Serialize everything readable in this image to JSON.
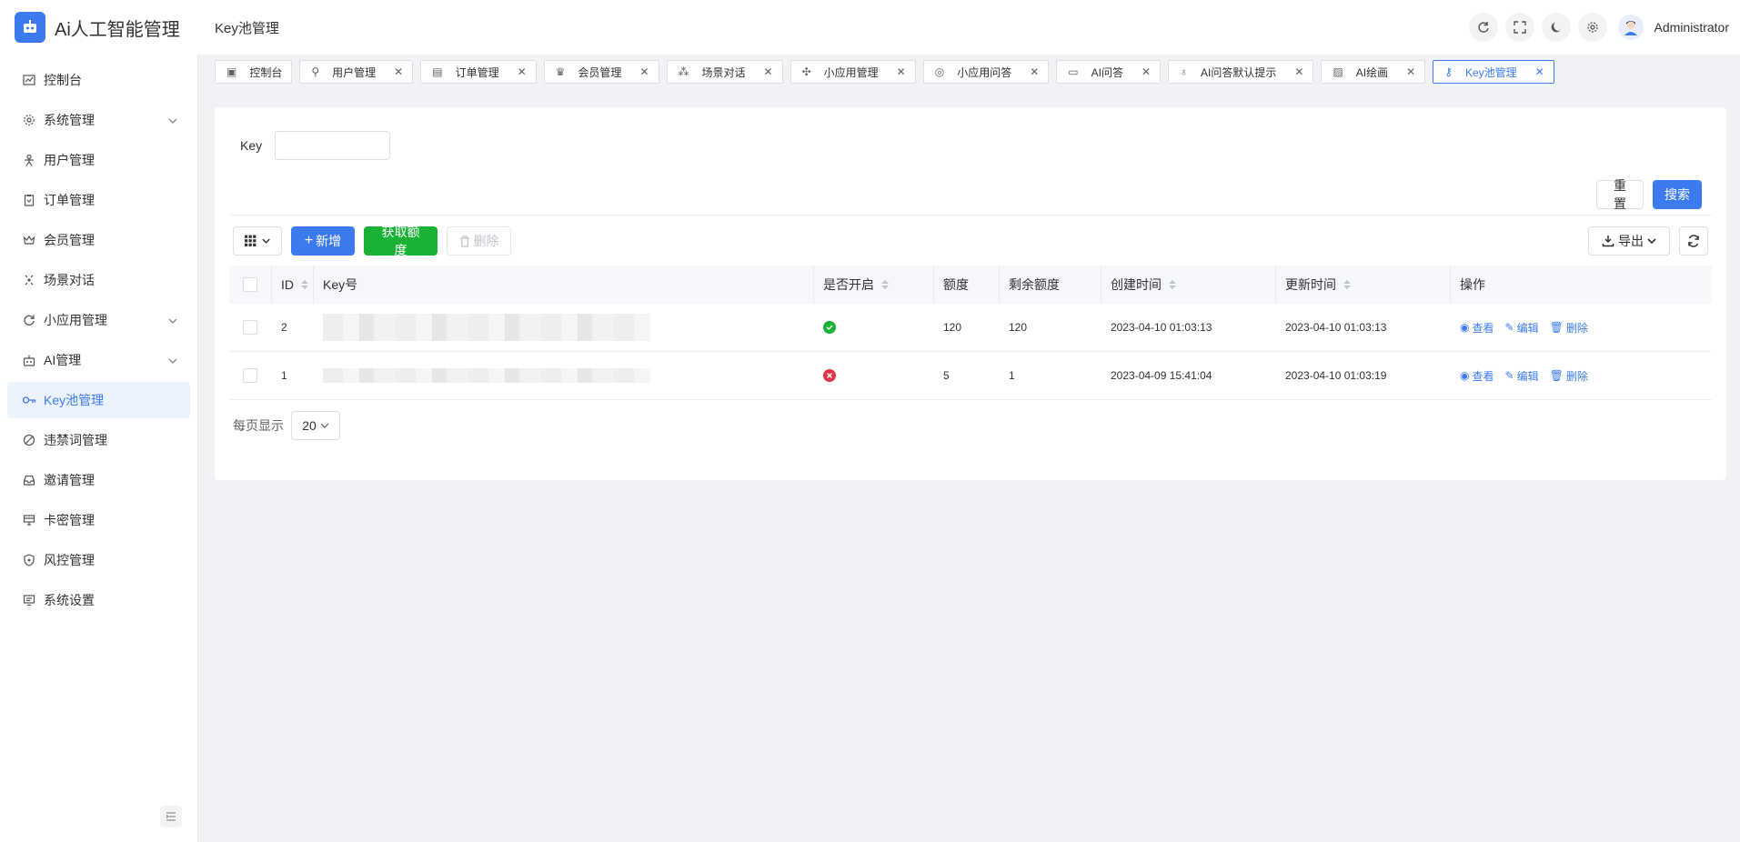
{
  "app": {
    "title": "Ai人工智能管理",
    "page_title": "Key池管理",
    "username": "Administrator"
  },
  "sidebar": {
    "items": [
      {
        "label": "控制台",
        "icon": "dashboard-icon"
      },
      {
        "label": "系统管理",
        "icon": "gear-icon",
        "expandable": true
      },
      {
        "label": "用户管理",
        "icon": "user-icon"
      },
      {
        "label": "订单管理",
        "icon": "clipboard-icon"
      },
      {
        "label": "会员管理",
        "icon": "crown-icon"
      },
      {
        "label": "场景对话",
        "icon": "scene-icon"
      },
      {
        "label": "小应用管理",
        "icon": "refresh-icon",
        "expandable": true
      },
      {
        "label": "AI管理",
        "icon": "robot-icon",
        "expandable": true
      },
      {
        "label": "Key池管理",
        "icon": "key-icon",
        "active": true
      },
      {
        "label": "违禁词管理",
        "icon": "ban-icon"
      },
      {
        "label": "邀请管理",
        "icon": "inbox-icon"
      },
      {
        "label": "卡密管理",
        "icon": "card-icon"
      },
      {
        "label": "风控管理",
        "icon": "shield-icon"
      },
      {
        "label": "系统设置",
        "icon": "settings-icon"
      }
    ]
  },
  "tabs": [
    {
      "label": "控制台",
      "closable": false
    },
    {
      "label": "用户管理",
      "closable": true
    },
    {
      "label": "订单管理",
      "closable": true
    },
    {
      "label": "会员管理",
      "closable": true
    },
    {
      "label": "场景对话",
      "closable": true
    },
    {
      "label": "小应用管理",
      "closable": true
    },
    {
      "label": "小应用问答",
      "closable": true
    },
    {
      "label": "AI问答",
      "closable": true
    },
    {
      "label": "AI问答默认提示",
      "closable": true
    },
    {
      "label": "AI绘画",
      "closable": true
    },
    {
      "label": "Key池管理",
      "closable": true,
      "active": true
    }
  ],
  "search": {
    "key_label": "Key",
    "reset_label": "重置",
    "search_label": "搜索"
  },
  "toolbar": {
    "add_label": "新增",
    "get_quota_label": "获取额度",
    "delete_label": "删除",
    "export_label": "导出"
  },
  "table": {
    "headers": {
      "id": "ID",
      "key": "Key号",
      "enabled": "是否开启",
      "quota": "额度",
      "remaining": "剩余额度",
      "created": "创建时间",
      "updated": "更新时间",
      "ops": "操作"
    },
    "rows": [
      {
        "id": "2",
        "enabled": true,
        "quota": "120",
        "remaining": "120",
        "created": "2023-04-10 01:03:13",
        "updated": "2023-04-10 01:03:13"
      },
      {
        "id": "1",
        "enabled": false,
        "quota": "5",
        "remaining": "1",
        "created": "2023-04-09 15:41:04",
        "updated": "2023-04-10 01:03:19"
      }
    ],
    "ops": {
      "view": "查看",
      "edit": "编辑",
      "delete": "删除"
    }
  },
  "pager": {
    "label": "每页显示",
    "page_size": "20"
  },
  "colors": {
    "primary": "#3b7bef",
    "success": "#19b234",
    "danger": "#e0344b"
  }
}
